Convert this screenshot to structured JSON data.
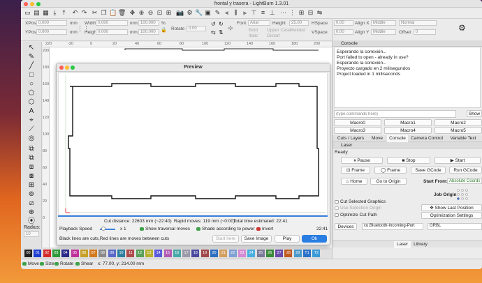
{
  "window": {
    "title": "frontal y trasera - LightBurn 1.3.01"
  },
  "props": {
    "xpos_label": "XPos",
    "xpos_value": "0.000",
    "ypos_label": "YPos",
    "ypos_value": "0.000",
    "unit": "mm",
    "width_label": "Width",
    "width_value": "0.000",
    "height_label": "Height",
    "height_value": "0.000",
    "pct_w": "100.000",
    "pct_h": "100.000",
    "pct": "%",
    "rotate_label": "Rotate",
    "rotate_value": "0.00",
    "font_label": "Font",
    "font_value": "Arial",
    "fheight_label": "Height",
    "fheight_value": "25.00",
    "hspace_label": "HSpace",
    "hspace_value": "0.00",
    "vspace_label": "VSpace",
    "vspace_value": "0.00",
    "alignx_label": "Align X",
    "alignx_value": "Middle",
    "aligny_label": "Align Y",
    "aligny_value": "Middle",
    "normal_value": "Normal",
    "offset_label": "Offset",
    "offset_value": "0",
    "bold": "Bold",
    "italic": "Italic",
    "upper": "Upper Case",
    "welded": "Welded",
    "distort": "Distort"
  },
  "ruler": {
    "top": [
      "220",
      "-20",
      "0",
      "20",
      "40",
      "60",
      "80",
      "100",
      "120",
      "140",
      "160",
      "180",
      "200"
    ],
    "left": [
      "200",
      "180",
      "160",
      "140",
      "120",
      "100",
      "80",
      "60",
      "40",
      "20",
      "0"
    ]
  },
  "preview": {
    "title": "Preview",
    "cut_distance": "Cut distance: 22603 mm (~22:40)",
    "rapid_moves": "Rapid moves: 119 mm (~0:00)",
    "total_time": "Total time estimated: 22:41",
    "speed_label": "Playback Speed",
    "speed_mult": "x 1",
    "show_traversal": "Show traversal moves",
    "shade_power": "Shade according to power",
    "invert": "Invert",
    "time_current": "22:41",
    "legend": "Black lines are cuts,Red lines are moves between cuts",
    "start_here": "Start here",
    "save_image": "Save Image",
    "play": "Play",
    "ok": "Ok"
  },
  "lefttools": {
    "radius_label": "Radius:",
    "radius_value": "10"
  },
  "palette": [
    "00",
    "01",
    "02",
    "03",
    "04",
    "05",
    "06",
    "07",
    "08",
    "09",
    "10",
    "11",
    "12",
    "13",
    "14",
    "15",
    "16",
    "17",
    "18",
    "19",
    "20",
    "21",
    "22",
    "23",
    "24",
    "25",
    "26",
    "27",
    "28",
    "29",
    "T1",
    "T2"
  ],
  "palette_colors": [
    "#222222",
    "#1f3fd1",
    "#d42a2a",
    "#2f9a3a",
    "#2a2a8a",
    "#c0309a",
    "#c8a028",
    "#d47a1e",
    "#8a8a8a",
    "#5a6ac8",
    "#2e7fa0",
    "#b04b4b",
    "#5aa05a",
    "#b8b030",
    "#5a5adc",
    "#b45ab4",
    "#48a8a8",
    "#9a9aa8",
    "#4a4aa0",
    "#a04848",
    "#2d6fc0",
    "#d4a060",
    "#7ea0d4",
    "#d48ad4",
    "#4ab0e0",
    "#7a7a9a",
    "#3a8a3a",
    "#6a4aaa",
    "#c05a20",
    "#4a9acc",
    "#2a70c8",
    "#3a9ad8"
  ],
  "statusbar": {
    "move": "Move",
    "size": "Size",
    "rotate": "Rotate",
    "shear": "Shear",
    "coords": "x: 77.00, y: 214.00 mm"
  },
  "console": {
    "header": "Console",
    "lines": [
      "Esperando la conexión...",
      "Port failed to open - already in use?",
      "Esperando la conexión...",
      "Proyecto cargado en 2 milisegundos",
      "Project loaded in 1 milliseconds"
    ],
    "placeholder": "(type commands here)",
    "show": "Show",
    "macros": [
      "Macro0",
      "Macro1",
      "Macro2",
      "Macro3",
      "Macro4",
      "Macro5"
    ]
  },
  "tabs_top": [
    "Cuts / Layers",
    "Move",
    "Console",
    "Camera Control",
    "Variable Text"
  ],
  "laser": {
    "header": "Laser",
    "status": "Ready",
    "pause": "Pause",
    "stop": "Stop",
    "start": "Start",
    "frame1": "Frame",
    "frame2": "Frame",
    "save_gcode": "Save GCode",
    "run_gcode": "Run GCode",
    "home": "Home",
    "go_origin": "Go to Origin",
    "start_from_label": "Start From:",
    "start_from_value": "Absolute Coords",
    "job_origin": "Job Origin",
    "cut_selected": "Cut Selected Graphics",
    "use_selection": "Use Selection Origin",
    "show_last": "Show Last Position",
    "optimize": "Optimize Cut Path",
    "opt_settings": "Optimization Settings",
    "devices": "Devices",
    "port": "cu.Bluetooth-Incoming-Port",
    "grbl": "GRBL"
  },
  "tabs_bottom": [
    "Laser",
    "Library"
  ]
}
